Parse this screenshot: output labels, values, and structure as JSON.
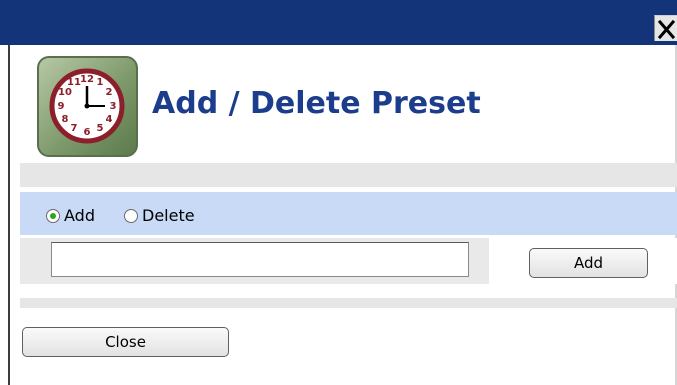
{
  "window": {
    "close_glyph": "✕",
    "title_bar_color": "#14347a"
  },
  "header": {
    "icon": "clock-icon",
    "title": "Add / Delete Preset",
    "title_color": "#1c3c8c"
  },
  "mode": {
    "options": [
      {
        "label": "Add",
        "checked": true
      },
      {
        "label": "Delete",
        "checked": false
      }
    ],
    "row_color": "#c8daf5"
  },
  "preset_input": {
    "value": "",
    "placeholder": ""
  },
  "buttons": {
    "add_label": "Add",
    "close_label": "Close"
  }
}
